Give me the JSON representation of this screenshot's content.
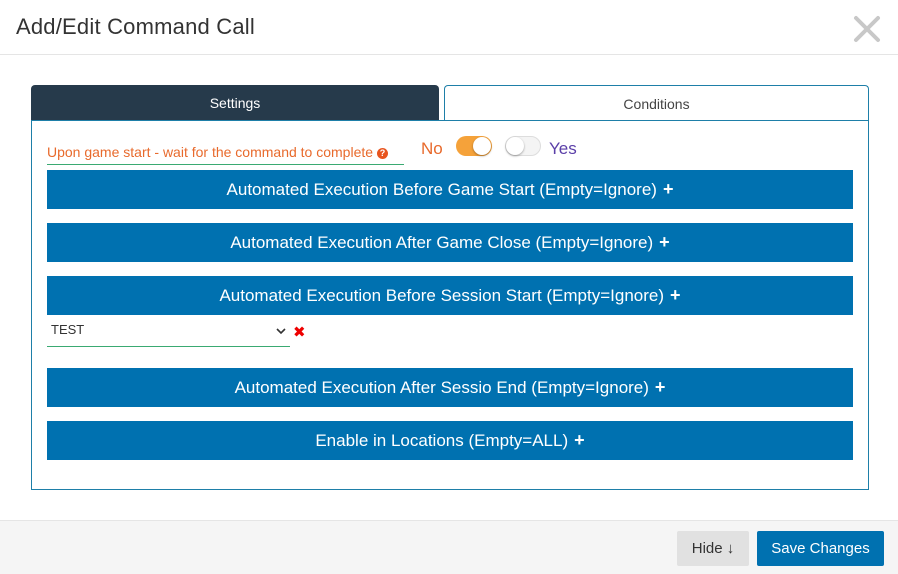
{
  "modal": {
    "title": "Add/Edit Command Call"
  },
  "tabs": [
    {
      "label": "Settings",
      "active": true
    },
    {
      "label": "Conditions",
      "active": false
    }
  ],
  "wait_option": {
    "label": "Upon game start - wait for the command to complete",
    "help_glyph": "?",
    "no_label": "No",
    "yes_label": "Yes",
    "value": "No"
  },
  "sections": [
    {
      "label": "Automated Execution Before Game Start (Empty=Ignore)",
      "plus": "+"
    },
    {
      "label": "Automated Execution After Game Close (Empty=Ignore)",
      "plus": "+"
    },
    {
      "label": "Automated Execution Before Session Start (Empty=Ignore)",
      "plus": "+"
    },
    {
      "label": "Automated Execution After Sessio End (Empty=Ignore)",
      "plus": "+"
    },
    {
      "label": "Enable in Locations (Empty=ALL)",
      "plus": "+"
    }
  ],
  "session_start_select": {
    "value": "TEST",
    "remove_glyph": "✖"
  },
  "footer": {
    "hide_label": "Hide ↓",
    "save_label": "Save Changes"
  },
  "colors": {
    "primary": "#0071b0",
    "tab_active": "#263a4b",
    "accent_orange": "#e86a2c",
    "toggle_on": "#f5a23a",
    "yes_purple": "#5b3fa8",
    "remove_red": "#ee0000"
  },
  "icons": [
    "close-icon",
    "help-icon",
    "plus-icon",
    "chevron-down-icon",
    "remove-icon"
  ]
}
